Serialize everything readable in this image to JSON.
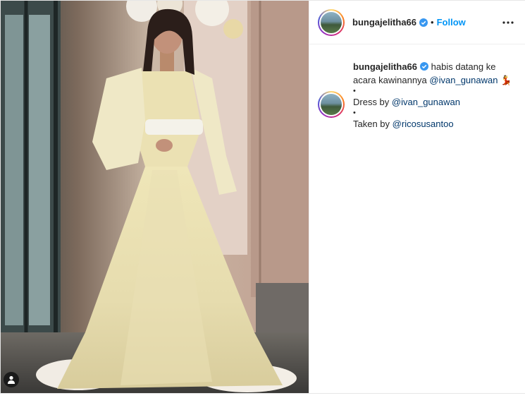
{
  "post": {
    "username": "bungajelitha66",
    "separator": "•",
    "follow_label": "Follow",
    "more_icon": "more-horizontal-icon",
    "verified_icon": "verified-badge-icon",
    "user_tag_icon": "user-tag-icon"
  },
  "caption": {
    "username": "bungajelitha66",
    "line1_text": "habis datang ke acara kawinannya",
    "mention1": "@ivan_gunawan",
    "emoji": "💃",
    "bullet": "•",
    "dress_prefix": "Dress by",
    "mention2": "@ivan_gunawan",
    "taken_prefix": "Taken by",
    "mention3": "@ricosusantoo"
  },
  "colors": {
    "follow_blue": "#0095f6",
    "mention_blue": "#00376b",
    "verified_blue": "#3897f0",
    "text": "#262626",
    "border": "#efefef"
  }
}
